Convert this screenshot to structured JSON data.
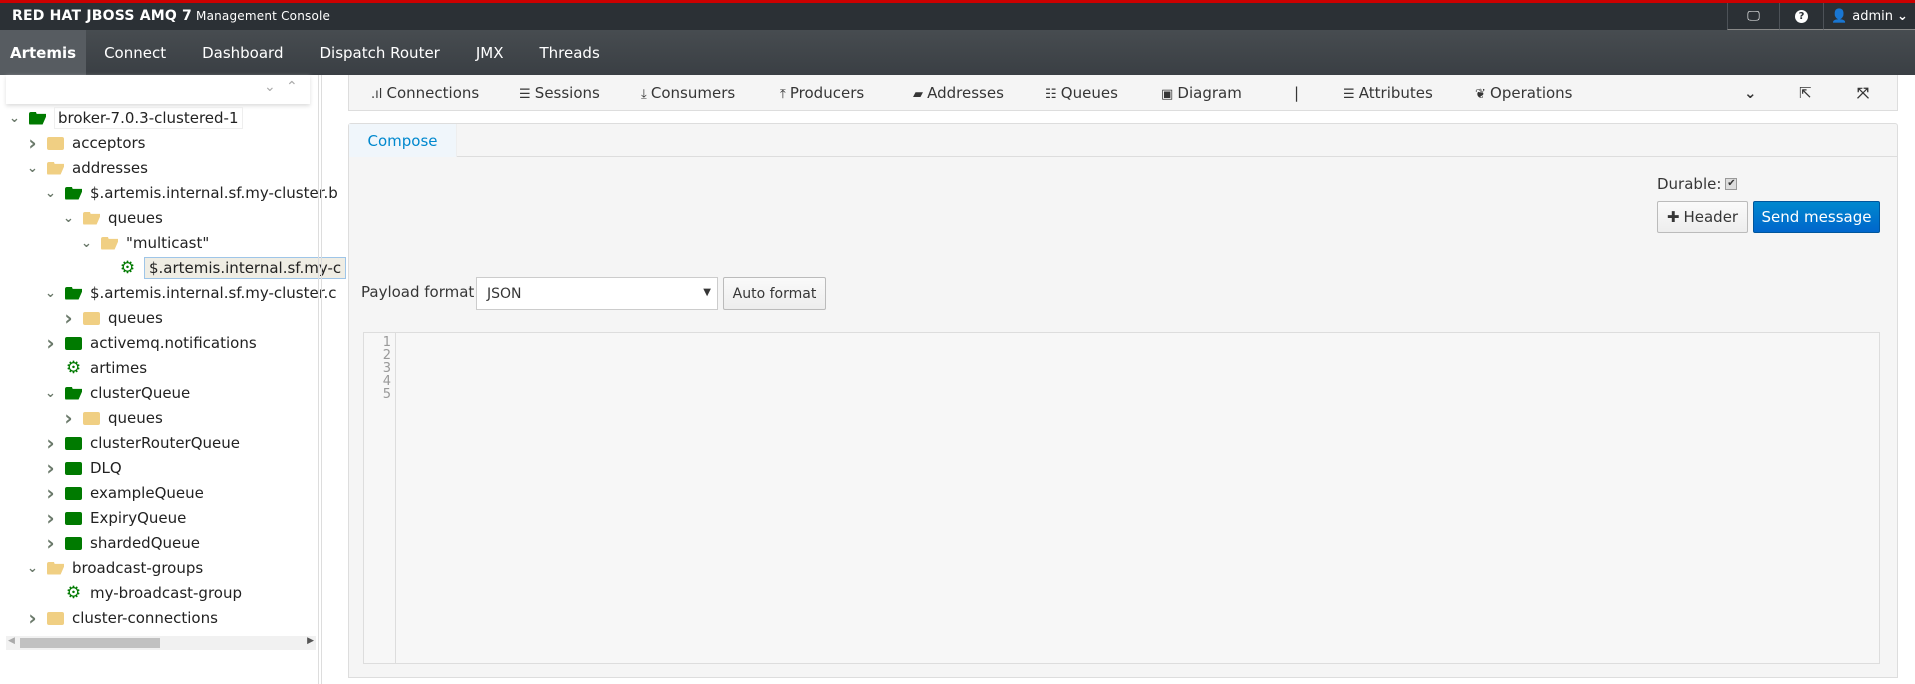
{
  "header": {
    "brand": "RED HAT JBOSS AMQ 7",
    "subtitle": "Management Console",
    "user": "admin",
    "icons": [
      "monitor-icon",
      "help-icon",
      "user-icon"
    ]
  },
  "nav": [
    "Artemis",
    "Connect",
    "Dashboard",
    "Dispatch Router",
    "JMX",
    "Threads"
  ],
  "tree": [
    {
      "label": "broker-7.0.3-clustered-1",
      "level": 0,
      "chev": "down",
      "icon": "green-open"
    },
    {
      "label": "acceptors",
      "level": 1,
      "chev": "right",
      "icon": "yellow"
    },
    {
      "label": "addresses",
      "level": 1,
      "chev": "down",
      "icon": "yellow-open"
    },
    {
      "label": "$.artemis.internal.sf.my-cluster.b",
      "level": 2,
      "chev": "down",
      "icon": "green-open"
    },
    {
      "label": "queues",
      "level": 3,
      "chev": "down",
      "icon": "yellow-open"
    },
    {
      "label": "\"multicast\"",
      "level": 4,
      "chev": "down",
      "icon": "yellow-open"
    },
    {
      "label": "$.artemis.internal.sf.my-c",
      "level": 5,
      "chev": "",
      "icon": "gear",
      "selected": true
    },
    {
      "label": "$.artemis.internal.sf.my-cluster.c",
      "level": 2,
      "chev": "down",
      "icon": "green-open"
    },
    {
      "label": "queues",
      "level": 3,
      "chev": "right",
      "icon": "yellow"
    },
    {
      "label": "activemq.notifications",
      "level": 2,
      "chev": "right",
      "icon": "green"
    },
    {
      "label": "artimes",
      "level": 2,
      "chev": "",
      "icon": "gear"
    },
    {
      "label": "clusterQueue",
      "level": 2,
      "chev": "down",
      "icon": "green-open"
    },
    {
      "label": "queues",
      "level": 3,
      "chev": "right",
      "icon": "yellow"
    },
    {
      "label": "clusterRouterQueue",
      "level": 2,
      "chev": "right",
      "icon": "green"
    },
    {
      "label": "DLQ",
      "level": 2,
      "chev": "right",
      "icon": "green"
    },
    {
      "label": "exampleQueue",
      "level": 2,
      "chev": "right",
      "icon": "green"
    },
    {
      "label": "ExpiryQueue",
      "level": 2,
      "chev": "right",
      "icon": "green"
    },
    {
      "label": "shardedQueue",
      "level": 2,
      "chev": "right",
      "icon": "green"
    },
    {
      "label": "broadcast-groups",
      "level": 1,
      "chev": "down",
      "icon": "yellow-open"
    },
    {
      "label": "my-broadcast-group",
      "level": 2,
      "chev": "",
      "icon": "gear"
    },
    {
      "label": "cluster-connections",
      "level": 1,
      "chev": "right",
      "icon": "yellow"
    }
  ],
  "toolbar": [
    {
      "label": "Connections",
      "icon": "signal-icon",
      "glyph": ".ıl"
    },
    {
      "label": "Sessions",
      "icon": "server-icon",
      "glyph": "☰"
    },
    {
      "label": "Consumers",
      "icon": "download-icon",
      "glyph": "⤓"
    },
    {
      "label": "Producers",
      "icon": "upload-icon",
      "glyph": "⤒"
    },
    {
      "label": "Addresses",
      "icon": "book-icon",
      "glyph": "▰"
    },
    {
      "label": "Queues",
      "icon": "list-icon",
      "glyph": "☷"
    },
    {
      "label": "Diagram",
      "icon": "image-icon",
      "glyph": "▣"
    },
    {
      "label": "|",
      "icon": "",
      "glyph": ""
    },
    {
      "label": "Attributes",
      "icon": "list-icon",
      "glyph": "☰"
    },
    {
      "label": "Operations",
      "icon": "leaf-icon",
      "glyph": "❦"
    }
  ],
  "compose": {
    "tab": "Compose",
    "durable_label": "Durable:",
    "durable": true,
    "header_btn": "Header",
    "send_btn": "Send message",
    "payload_label": "Payload format:",
    "payload_value": "JSON",
    "auto_format": "Auto format",
    "line_numbers": [
      "1",
      "2",
      "3",
      "4",
      "5"
    ]
  },
  "colors": {
    "accent": "#0088ce",
    "primary_btn": "#0066cc",
    "folder_green": "#007a00",
    "folder_yellow": "#f0cf83",
    "brand_red": "#cc0000"
  }
}
